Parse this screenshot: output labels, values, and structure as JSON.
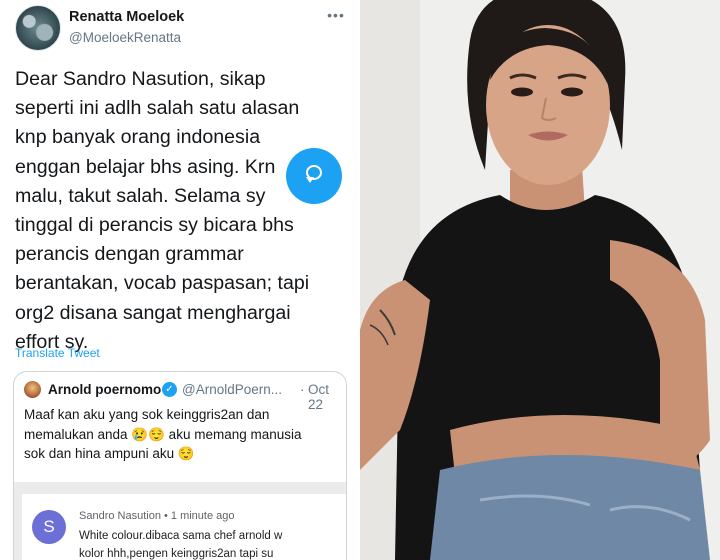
{
  "tweet": {
    "name": "Renatta Moeloek",
    "handle": "@MoeloekRenatta",
    "more_icon": "more-dots-icon",
    "text": "Dear Sandro Nasution, sikap\nseperti ini adlh salah satu alasan\nknp banyak orang indonesia\nenggan belajar bhs asing. Krn\nmalu, takut salah. Selama sy\ntinggal di perancis sy bicara bhs\nperancis dengan grammar\nberantakan, vocab paspasan; tapi\norg2 disana sangat menghargai\neffort sy.",
    "translate_label": "Translate Tweet"
  },
  "quote": {
    "name": "Arnold poernomo",
    "verified_icon": "verified-badge-icon",
    "handle": "@ArnoldPoern...",
    "separator": "·",
    "date": "Oct 22",
    "text": "Maaf kan aku yang sok keinggris2an dan\nmemalukan anda 😢😌 aku memang manusia\nsok dan hina ampuni aku 😌",
    "comment": {
      "avatar_letter": "S",
      "author_line": "Sandro Nasution • 1 minute ago",
      "text": "White colour.dibaca sama chef arnold w\nkolor hhh,pengen keinggris2an tapi su"
    }
  },
  "fab_icon": "reply-bubble-icon",
  "photo": {
    "description_icon": "portrait-photo"
  },
  "colors": {
    "accent": "#1da1f2",
    "text": "#14171a",
    "muted": "#657786",
    "comment_avatar": "#6b6fd6"
  }
}
